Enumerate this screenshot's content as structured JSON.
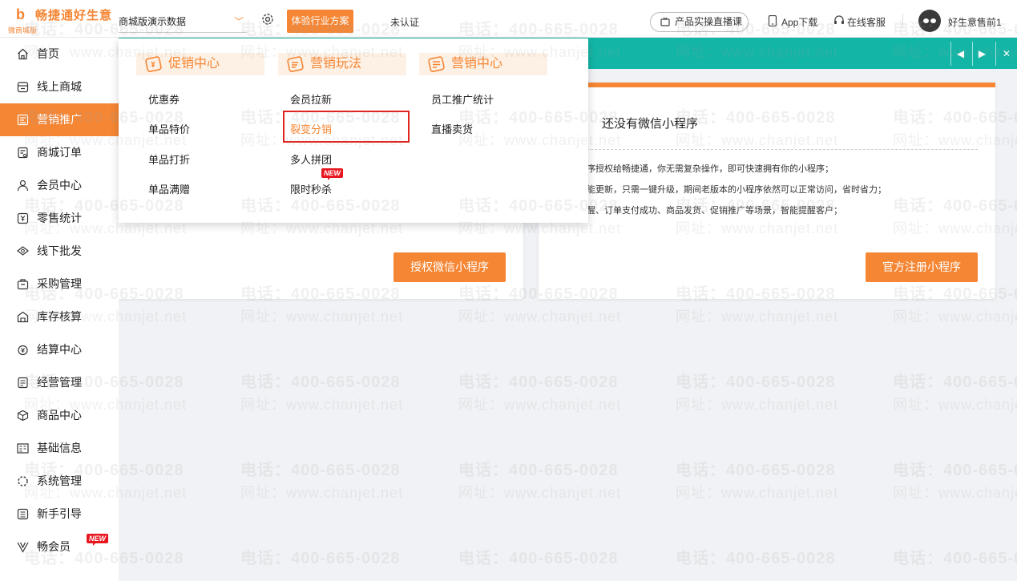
{
  "brand": {
    "name": "畅捷通好生意",
    "sub": "微商城版",
    "mark": "b"
  },
  "topbar": {
    "store": "商城版演示数据",
    "experience_btn": "体验行业方案",
    "certification": "未认证",
    "live_course": "产品实操直播课",
    "app_download": "App下载",
    "online_service": "在线客服",
    "username": "好生意售前1"
  },
  "sidebar": {
    "items": [
      {
        "label": "首页",
        "icon": "home-icon"
      },
      {
        "label": "线上商城",
        "icon": "shop-icon"
      },
      {
        "label": "营销推广",
        "icon": "promotion-icon",
        "active": true
      },
      {
        "label": "商城订单",
        "icon": "order-icon"
      },
      {
        "label": "会员中心",
        "icon": "member-icon"
      },
      {
        "label": "零售统计",
        "icon": "retail-icon"
      },
      {
        "label": "线下批发",
        "icon": "wholesale-icon"
      },
      {
        "label": "采购管理",
        "icon": "purchase-icon"
      },
      {
        "label": "库存核算",
        "icon": "inventory-icon"
      },
      {
        "label": "结算中心",
        "icon": "settlement-icon"
      },
      {
        "label": "经营管理",
        "icon": "management-icon"
      },
      {
        "label": "商品中心",
        "icon": "product-icon"
      },
      {
        "label": "基础信息",
        "icon": "basic-info-icon"
      },
      {
        "label": "系统管理",
        "icon": "system-icon"
      },
      {
        "label": "新手引导",
        "icon": "guide-icon"
      },
      {
        "label": "畅会员",
        "icon": "vip-icon",
        "badge": "NEW"
      }
    ]
  },
  "dropdown": {
    "columns": [
      {
        "title": "促销中心",
        "items": [
          "优惠券",
          "单品特价",
          "单品打折",
          "单品满赠"
        ]
      },
      {
        "title": "营销玩法",
        "items": [
          "会员拉新",
          "裂变分销",
          "多人拼团",
          "限时秒杀"
        ],
        "active_index": 1,
        "badge_index": 3,
        "badge": "NEW"
      },
      {
        "title": "营销中心",
        "items": [
          "员工推广统计",
          "直播卖货"
        ]
      }
    ]
  },
  "card_left": {
    "button": "授权微信小程序"
  },
  "card_right": {
    "title": "还没有微信小程序",
    "lines": [
      "序授权给畅捷通，你无需复杂操作，即可快速拥有你的小程序；",
      "能更新，只需一键升级，期间老版本的小程序依然可以正常访问，省时省力；",
      "醒、订单支付成功、商品发货、促销推广等场景，智能提醒客户；"
    ],
    "button": "官方注册小程序"
  },
  "tab_controls": {
    "prev": "◀",
    "next": "▶",
    "close": "✕"
  },
  "watermark": {
    "phone": "电话：400-665-0028",
    "url": "网址：www.chanjet.net"
  },
  "colors": {
    "accent": "#f58634",
    "teal": "#13b5a6",
    "red": "#e0241d"
  }
}
